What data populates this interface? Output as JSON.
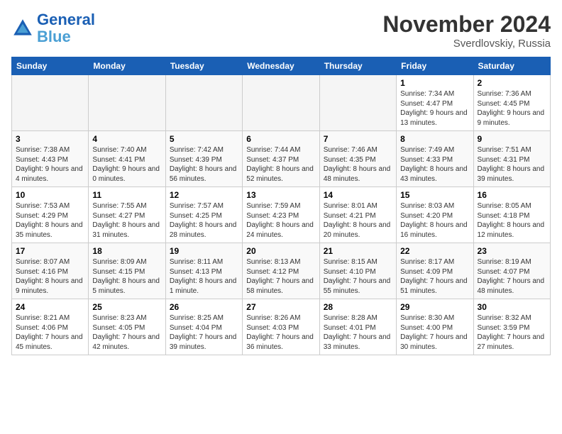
{
  "header": {
    "logo_line1": "General",
    "logo_line2": "Blue",
    "month_title": "November 2024",
    "location": "Sverdlovskiy, Russia"
  },
  "days_of_week": [
    "Sunday",
    "Monday",
    "Tuesday",
    "Wednesday",
    "Thursday",
    "Friday",
    "Saturday"
  ],
  "weeks": [
    [
      {
        "day": "",
        "empty": true
      },
      {
        "day": "",
        "empty": true
      },
      {
        "day": "",
        "empty": true
      },
      {
        "day": "",
        "empty": true
      },
      {
        "day": "",
        "empty": true
      },
      {
        "day": "1",
        "sunrise": "7:34 AM",
        "sunset": "4:47 PM",
        "daylight": "9 hours and 13 minutes."
      },
      {
        "day": "2",
        "sunrise": "7:36 AM",
        "sunset": "4:45 PM",
        "daylight": "9 hours and 9 minutes."
      }
    ],
    [
      {
        "day": "3",
        "sunrise": "7:38 AM",
        "sunset": "4:43 PM",
        "daylight": "9 hours and 4 minutes."
      },
      {
        "day": "4",
        "sunrise": "7:40 AM",
        "sunset": "4:41 PM",
        "daylight": "9 hours and 0 minutes."
      },
      {
        "day": "5",
        "sunrise": "7:42 AM",
        "sunset": "4:39 PM",
        "daylight": "8 hours and 56 minutes."
      },
      {
        "day": "6",
        "sunrise": "7:44 AM",
        "sunset": "4:37 PM",
        "daylight": "8 hours and 52 minutes."
      },
      {
        "day": "7",
        "sunrise": "7:46 AM",
        "sunset": "4:35 PM",
        "daylight": "8 hours and 48 minutes."
      },
      {
        "day": "8",
        "sunrise": "7:49 AM",
        "sunset": "4:33 PM",
        "daylight": "8 hours and 43 minutes."
      },
      {
        "day": "9",
        "sunrise": "7:51 AM",
        "sunset": "4:31 PM",
        "daylight": "8 hours and 39 minutes."
      }
    ],
    [
      {
        "day": "10",
        "sunrise": "7:53 AM",
        "sunset": "4:29 PM",
        "daylight": "8 hours and 35 minutes."
      },
      {
        "day": "11",
        "sunrise": "7:55 AM",
        "sunset": "4:27 PM",
        "daylight": "8 hours and 31 minutes."
      },
      {
        "day": "12",
        "sunrise": "7:57 AM",
        "sunset": "4:25 PM",
        "daylight": "8 hours and 28 minutes."
      },
      {
        "day": "13",
        "sunrise": "7:59 AM",
        "sunset": "4:23 PM",
        "daylight": "8 hours and 24 minutes."
      },
      {
        "day": "14",
        "sunrise": "8:01 AM",
        "sunset": "4:21 PM",
        "daylight": "8 hours and 20 minutes."
      },
      {
        "day": "15",
        "sunrise": "8:03 AM",
        "sunset": "4:20 PM",
        "daylight": "8 hours and 16 minutes."
      },
      {
        "day": "16",
        "sunrise": "8:05 AM",
        "sunset": "4:18 PM",
        "daylight": "8 hours and 12 minutes."
      }
    ],
    [
      {
        "day": "17",
        "sunrise": "8:07 AM",
        "sunset": "4:16 PM",
        "daylight": "8 hours and 9 minutes."
      },
      {
        "day": "18",
        "sunrise": "8:09 AM",
        "sunset": "4:15 PM",
        "daylight": "8 hours and 5 minutes."
      },
      {
        "day": "19",
        "sunrise": "8:11 AM",
        "sunset": "4:13 PM",
        "daylight": "8 hours and 1 minute."
      },
      {
        "day": "20",
        "sunrise": "8:13 AM",
        "sunset": "4:12 PM",
        "daylight": "7 hours and 58 minutes."
      },
      {
        "day": "21",
        "sunrise": "8:15 AM",
        "sunset": "4:10 PM",
        "daylight": "7 hours and 55 minutes."
      },
      {
        "day": "22",
        "sunrise": "8:17 AM",
        "sunset": "4:09 PM",
        "daylight": "7 hours and 51 minutes."
      },
      {
        "day": "23",
        "sunrise": "8:19 AM",
        "sunset": "4:07 PM",
        "daylight": "7 hours and 48 minutes."
      }
    ],
    [
      {
        "day": "24",
        "sunrise": "8:21 AM",
        "sunset": "4:06 PM",
        "daylight": "7 hours and 45 minutes."
      },
      {
        "day": "25",
        "sunrise": "8:23 AM",
        "sunset": "4:05 PM",
        "daylight": "7 hours and 42 minutes."
      },
      {
        "day": "26",
        "sunrise": "8:25 AM",
        "sunset": "4:04 PM",
        "daylight": "7 hours and 39 minutes."
      },
      {
        "day": "27",
        "sunrise": "8:26 AM",
        "sunset": "4:03 PM",
        "daylight": "7 hours and 36 minutes."
      },
      {
        "day": "28",
        "sunrise": "8:28 AM",
        "sunset": "4:01 PM",
        "daylight": "7 hours and 33 minutes."
      },
      {
        "day": "29",
        "sunrise": "8:30 AM",
        "sunset": "4:00 PM",
        "daylight": "7 hours and 30 minutes."
      },
      {
        "day": "30",
        "sunrise": "8:32 AM",
        "sunset": "3:59 PM",
        "daylight": "7 hours and 27 minutes."
      }
    ]
  ]
}
